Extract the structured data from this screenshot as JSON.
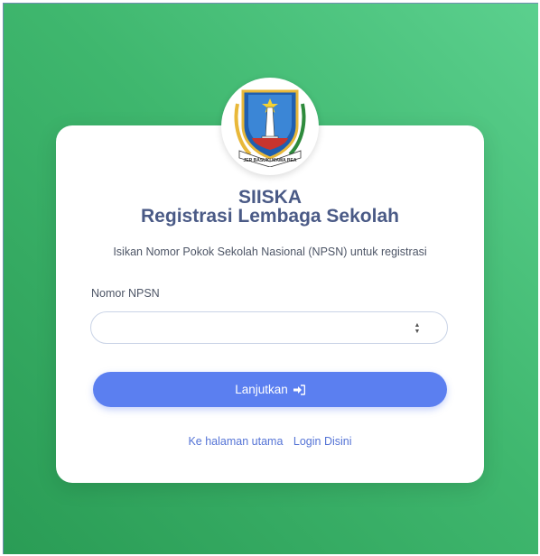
{
  "header": {
    "app_name": "SIISKA",
    "title": "Registrasi Lembaga Sekolah",
    "subtitle": "Isikan Nomor Pokok Sekolah Nasional (NPSN) untuk registrasi"
  },
  "form": {
    "npsn_label": "Nomor NPSN",
    "npsn_value": "",
    "npsn_placeholder": ""
  },
  "actions": {
    "submit_label": "Lanjutkan",
    "submit_icon": "sign-in-icon"
  },
  "links": {
    "home": "Ke halaman utama",
    "login": "Login Disini"
  },
  "logo": {
    "name": "east-java-coat-of-arms",
    "ribbon_text": "JER BASUKI MAWA BEA"
  },
  "colors": {
    "accent": "#5b7ff0",
    "title": "#4a5a86",
    "background_start": "#5bd08e",
    "background_end": "#2a9c55"
  }
}
